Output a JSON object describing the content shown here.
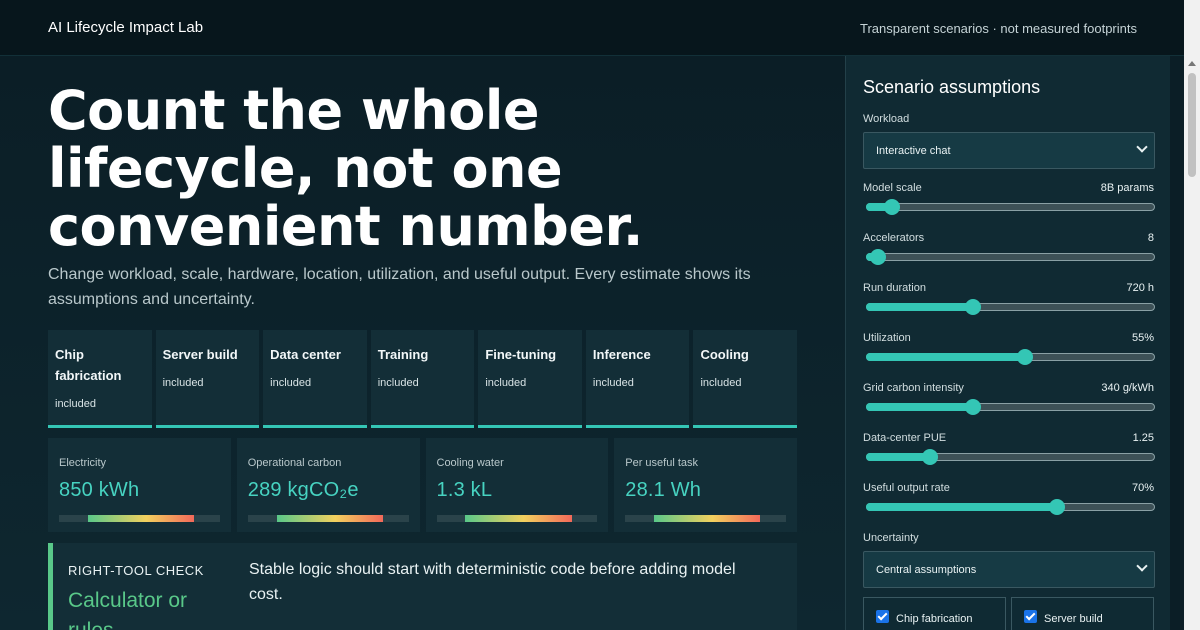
{
  "header": {
    "brand": "AI Lifecycle Impact Lab",
    "tagline": "Transparent scenarios · not measured footprints"
  },
  "hero": {
    "title": "Count the whole lifecycle, not one convenient number.",
    "subtitle": "Change workload, scale, hardware, location, utilization, and useful output. Every estimate shows its assumptions and uncertainty."
  },
  "stages": [
    {
      "name": "Chip fabrication",
      "status": "included"
    },
    {
      "name": "Server build",
      "status": "included"
    },
    {
      "name": "Data center",
      "status": "included"
    },
    {
      "name": "Training",
      "status": "included"
    },
    {
      "name": "Fine-tuning",
      "status": "included"
    },
    {
      "name": "Inference",
      "status": "included"
    },
    {
      "name": "Cooling",
      "status": "included"
    }
  ],
  "metrics": [
    {
      "label": "Electricity",
      "value": "850 kWh"
    },
    {
      "label": "Operational carbon",
      "value": "289 kgCO₂e"
    },
    {
      "label": "Cooling water",
      "value": "1.3 kL"
    },
    {
      "label": "Per useful task",
      "value": "28.1 Wh"
    }
  ],
  "check": {
    "kicker": "RIGHT-TOOL CHECK",
    "heading": "Calculator or rules",
    "text": "Stable logic should start with deterministic code before adding model cost."
  },
  "panel": {
    "title": "Scenario assumptions",
    "workload": {
      "label": "Workload",
      "selected": "Interactive chat"
    },
    "sliders": [
      {
        "label": "Model scale",
        "value": "8B params",
        "fraction": 0.09
      },
      {
        "label": "Accelerators",
        "value": "8",
        "fraction": 0.04
      },
      {
        "label": "Run duration",
        "value": "720 h",
        "fraction": 0.37
      },
      {
        "label": "Utilization",
        "value": "55%",
        "fraction": 0.55
      },
      {
        "label": "Grid carbon intensity",
        "value": "340 g/kWh",
        "fraction": 0.37
      },
      {
        "label": "Data-center PUE",
        "value": "1.25",
        "fraction": 0.22
      },
      {
        "label": "Useful output rate",
        "value": "70%",
        "fraction": 0.66
      }
    ],
    "uncertainty": {
      "label": "Uncertainty",
      "selected": "Central assumptions"
    },
    "checkboxes": [
      {
        "label": "Chip fabrication",
        "checked": true
      },
      {
        "label": "Server build",
        "checked": true
      }
    ]
  },
  "colors": {
    "accent": "#34c6b5",
    "check_accent": "#59c889",
    "background": "#0b1e26",
    "card": "#132e37"
  }
}
